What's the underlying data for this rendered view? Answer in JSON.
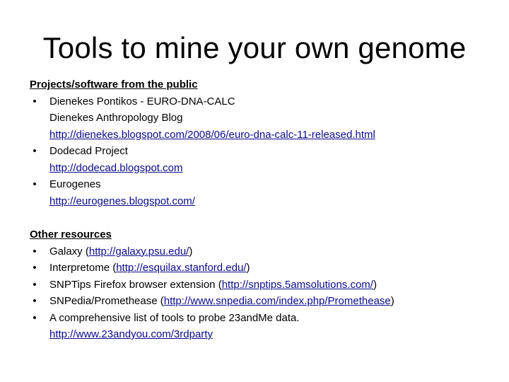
{
  "title": "Tools to mine your own genome",
  "bullet_glyph": "•",
  "sections": {
    "public": {
      "heading": "Projects/software from the public",
      "items": [
        {
          "line1": "Dienekes Pontikos - EURO-DNA-CALC",
          "line2": "Dienekes Anthropology Blog",
          "link": "http://dienekes.blogspot.com/2008/06/euro-dna-calc-11-released.html"
        },
        {
          "line1": "Dodecad Project",
          "link": "http://dodecad.blogspot.com"
        },
        {
          "line1": "Eurogenes",
          "link": "http://eurogenes.blogspot.com/"
        }
      ]
    },
    "other": {
      "heading": "Other resources",
      "items": [
        {
          "prefix": "Galaxy (",
          "link": "http://galaxy.psu.edu/",
          "suffix": ")"
        },
        {
          "prefix": "Interpretome (",
          "link": "http://esquilax.stanford.edu/",
          "suffix": ")"
        },
        {
          "prefix": "SNPTips Firefox browser extension (",
          "link": "http://snptips.5amsolutions.com/",
          "suffix": ")"
        },
        {
          "prefix": "SNPedia/Promethease (",
          "link": "http://www.snpedia.com/index.php/Promethease",
          "suffix": ")"
        },
        {
          "prefix": "A comprehensive list of tools to probe 23andMe data.",
          "link": "http://www.23andyou.com/3rdparty"
        }
      ]
    }
  },
  "colors": {
    "link": "#0a0a8c",
    "text": "#000000",
    "background": "#ffffff"
  }
}
